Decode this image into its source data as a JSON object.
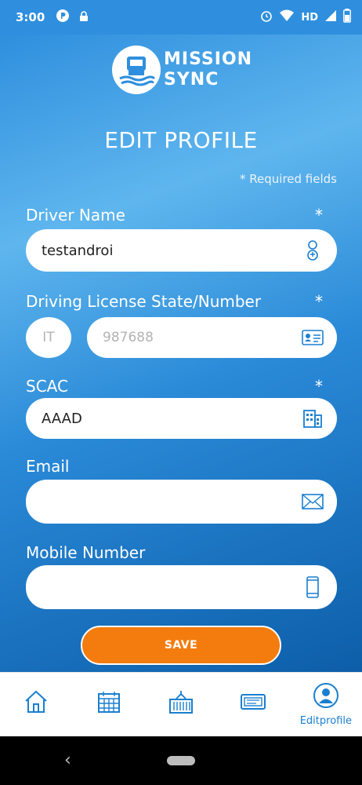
{
  "status_bar": {
    "time": "3:00",
    "network_label": "HD",
    "icons": [
      "notification-p-icon",
      "lock-icon",
      "alarm-icon",
      "wifi-icon",
      "signal-icon",
      "battery-icon"
    ]
  },
  "logo": {
    "line1": "MISSION",
    "line2": "SYNC"
  },
  "page_title": "EDIT PROFILE",
  "required_note": "*  Required fields",
  "form": {
    "driver_name": {
      "label": "Driver Name",
      "required_mark": "*",
      "value": "testandroi",
      "icon": "person-icon"
    },
    "license": {
      "label": "Driving License State/Number",
      "required_mark": "*",
      "state": "IT",
      "number": "987688",
      "icon": "id-card-icon"
    },
    "scac": {
      "label": "SCAC",
      "required_mark": "*",
      "value": "AAAD",
      "icon": "building-icon"
    },
    "email": {
      "label": "Email",
      "value": "",
      "icon": "envelope-icon"
    },
    "mobile": {
      "label": "Mobile Number",
      "value": "",
      "icon": "phone-icon"
    }
  },
  "save_button": "SAVE",
  "bottom_nav": {
    "items": [
      {
        "icon": "home-icon",
        "label": ""
      },
      {
        "icon": "calendar-icon",
        "label": ""
      },
      {
        "icon": "container-icon",
        "label": ""
      },
      {
        "icon": "ticket-icon",
        "label": ""
      },
      {
        "icon": "profile-icon",
        "label": "Editprofile"
      }
    ]
  },
  "colors": {
    "accent": "#2f8fde",
    "button": "#f47c0f",
    "icon": "#1a7fd0"
  }
}
